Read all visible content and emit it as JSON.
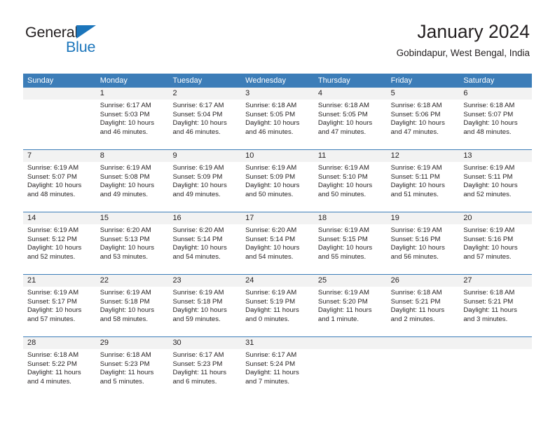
{
  "brand": {
    "name_part1": "General",
    "name_part2": "Blue",
    "accent_color": "#1b75bb"
  },
  "header": {
    "title": "January 2024",
    "subtitle": "Gobindapur, West Bengal, India"
  },
  "calendar": {
    "header_bg": "#3c7db8",
    "day_band_bg": "#f2f2f2",
    "weekdays": [
      "Sunday",
      "Monday",
      "Tuesday",
      "Wednesday",
      "Thursday",
      "Friday",
      "Saturday"
    ],
    "labels": {
      "sunrise": "Sunrise:",
      "sunset": "Sunset:",
      "daylight": "Daylight:"
    },
    "weeks": [
      [
        {
          "day": "",
          "sunrise": "",
          "sunset": "",
          "daylight_line1": "",
          "daylight_line2": ""
        },
        {
          "day": "1",
          "sunrise": "Sunrise: 6:17 AM",
          "sunset": "Sunset: 5:03 PM",
          "daylight_line1": "Daylight: 10 hours",
          "daylight_line2": "and 46 minutes."
        },
        {
          "day": "2",
          "sunrise": "Sunrise: 6:17 AM",
          "sunset": "Sunset: 5:04 PM",
          "daylight_line1": "Daylight: 10 hours",
          "daylight_line2": "and 46 minutes."
        },
        {
          "day": "3",
          "sunrise": "Sunrise: 6:18 AM",
          "sunset": "Sunset: 5:05 PM",
          "daylight_line1": "Daylight: 10 hours",
          "daylight_line2": "and 46 minutes."
        },
        {
          "day": "4",
          "sunrise": "Sunrise: 6:18 AM",
          "sunset": "Sunset: 5:05 PM",
          "daylight_line1": "Daylight: 10 hours",
          "daylight_line2": "and 47 minutes."
        },
        {
          "day": "5",
          "sunrise": "Sunrise: 6:18 AM",
          "sunset": "Sunset: 5:06 PM",
          "daylight_line1": "Daylight: 10 hours",
          "daylight_line2": "and 47 minutes."
        },
        {
          "day": "6",
          "sunrise": "Sunrise: 6:18 AM",
          "sunset": "Sunset: 5:07 PM",
          "daylight_line1": "Daylight: 10 hours",
          "daylight_line2": "and 48 minutes."
        }
      ],
      [
        {
          "day": "7",
          "sunrise": "Sunrise: 6:19 AM",
          "sunset": "Sunset: 5:07 PM",
          "daylight_line1": "Daylight: 10 hours",
          "daylight_line2": "and 48 minutes."
        },
        {
          "day": "8",
          "sunrise": "Sunrise: 6:19 AM",
          "sunset": "Sunset: 5:08 PM",
          "daylight_line1": "Daylight: 10 hours",
          "daylight_line2": "and 49 minutes."
        },
        {
          "day": "9",
          "sunrise": "Sunrise: 6:19 AM",
          "sunset": "Sunset: 5:09 PM",
          "daylight_line1": "Daylight: 10 hours",
          "daylight_line2": "and 49 minutes."
        },
        {
          "day": "10",
          "sunrise": "Sunrise: 6:19 AM",
          "sunset": "Sunset: 5:09 PM",
          "daylight_line1": "Daylight: 10 hours",
          "daylight_line2": "and 50 minutes."
        },
        {
          "day": "11",
          "sunrise": "Sunrise: 6:19 AM",
          "sunset": "Sunset: 5:10 PM",
          "daylight_line1": "Daylight: 10 hours",
          "daylight_line2": "and 50 minutes."
        },
        {
          "day": "12",
          "sunrise": "Sunrise: 6:19 AM",
          "sunset": "Sunset: 5:11 PM",
          "daylight_line1": "Daylight: 10 hours",
          "daylight_line2": "and 51 minutes."
        },
        {
          "day": "13",
          "sunrise": "Sunrise: 6:19 AM",
          "sunset": "Sunset: 5:11 PM",
          "daylight_line1": "Daylight: 10 hours",
          "daylight_line2": "and 52 minutes."
        }
      ],
      [
        {
          "day": "14",
          "sunrise": "Sunrise: 6:19 AM",
          "sunset": "Sunset: 5:12 PM",
          "daylight_line1": "Daylight: 10 hours",
          "daylight_line2": "and 52 minutes."
        },
        {
          "day": "15",
          "sunrise": "Sunrise: 6:20 AM",
          "sunset": "Sunset: 5:13 PM",
          "daylight_line1": "Daylight: 10 hours",
          "daylight_line2": "and 53 minutes."
        },
        {
          "day": "16",
          "sunrise": "Sunrise: 6:20 AM",
          "sunset": "Sunset: 5:14 PM",
          "daylight_line1": "Daylight: 10 hours",
          "daylight_line2": "and 54 minutes."
        },
        {
          "day": "17",
          "sunrise": "Sunrise: 6:20 AM",
          "sunset": "Sunset: 5:14 PM",
          "daylight_line1": "Daylight: 10 hours",
          "daylight_line2": "and 54 minutes."
        },
        {
          "day": "18",
          "sunrise": "Sunrise: 6:19 AM",
          "sunset": "Sunset: 5:15 PM",
          "daylight_line1": "Daylight: 10 hours",
          "daylight_line2": "and 55 minutes."
        },
        {
          "day": "19",
          "sunrise": "Sunrise: 6:19 AM",
          "sunset": "Sunset: 5:16 PM",
          "daylight_line1": "Daylight: 10 hours",
          "daylight_line2": "and 56 minutes."
        },
        {
          "day": "20",
          "sunrise": "Sunrise: 6:19 AM",
          "sunset": "Sunset: 5:16 PM",
          "daylight_line1": "Daylight: 10 hours",
          "daylight_line2": "and 57 minutes."
        }
      ],
      [
        {
          "day": "21",
          "sunrise": "Sunrise: 6:19 AM",
          "sunset": "Sunset: 5:17 PM",
          "daylight_line1": "Daylight: 10 hours",
          "daylight_line2": "and 57 minutes."
        },
        {
          "day": "22",
          "sunrise": "Sunrise: 6:19 AM",
          "sunset": "Sunset: 5:18 PM",
          "daylight_line1": "Daylight: 10 hours",
          "daylight_line2": "and 58 minutes."
        },
        {
          "day": "23",
          "sunrise": "Sunrise: 6:19 AM",
          "sunset": "Sunset: 5:18 PM",
          "daylight_line1": "Daylight: 10 hours",
          "daylight_line2": "and 59 minutes."
        },
        {
          "day": "24",
          "sunrise": "Sunrise: 6:19 AM",
          "sunset": "Sunset: 5:19 PM",
          "daylight_line1": "Daylight: 11 hours",
          "daylight_line2": "and 0 minutes."
        },
        {
          "day": "25",
          "sunrise": "Sunrise: 6:19 AM",
          "sunset": "Sunset: 5:20 PM",
          "daylight_line1": "Daylight: 11 hours",
          "daylight_line2": "and 1 minute."
        },
        {
          "day": "26",
          "sunrise": "Sunrise: 6:18 AM",
          "sunset": "Sunset: 5:21 PM",
          "daylight_line1": "Daylight: 11 hours",
          "daylight_line2": "and 2 minutes."
        },
        {
          "day": "27",
          "sunrise": "Sunrise: 6:18 AM",
          "sunset": "Sunset: 5:21 PM",
          "daylight_line1": "Daylight: 11 hours",
          "daylight_line2": "and 3 minutes."
        }
      ],
      [
        {
          "day": "28",
          "sunrise": "Sunrise: 6:18 AM",
          "sunset": "Sunset: 5:22 PM",
          "daylight_line1": "Daylight: 11 hours",
          "daylight_line2": "and 4 minutes."
        },
        {
          "day": "29",
          "sunrise": "Sunrise: 6:18 AM",
          "sunset": "Sunset: 5:23 PM",
          "daylight_line1": "Daylight: 11 hours",
          "daylight_line2": "and 5 minutes."
        },
        {
          "day": "30",
          "sunrise": "Sunrise: 6:17 AM",
          "sunset": "Sunset: 5:23 PM",
          "daylight_line1": "Daylight: 11 hours",
          "daylight_line2": "and 6 minutes."
        },
        {
          "day": "31",
          "sunrise": "Sunrise: 6:17 AM",
          "sunset": "Sunset: 5:24 PM",
          "daylight_line1": "Daylight: 11 hours",
          "daylight_line2": "and 7 minutes."
        },
        {
          "day": "",
          "sunrise": "",
          "sunset": "",
          "daylight_line1": "",
          "daylight_line2": ""
        },
        {
          "day": "",
          "sunrise": "",
          "sunset": "",
          "daylight_line1": "",
          "daylight_line2": ""
        },
        {
          "day": "",
          "sunrise": "",
          "sunset": "",
          "daylight_line1": "",
          "daylight_line2": ""
        }
      ]
    ]
  }
}
